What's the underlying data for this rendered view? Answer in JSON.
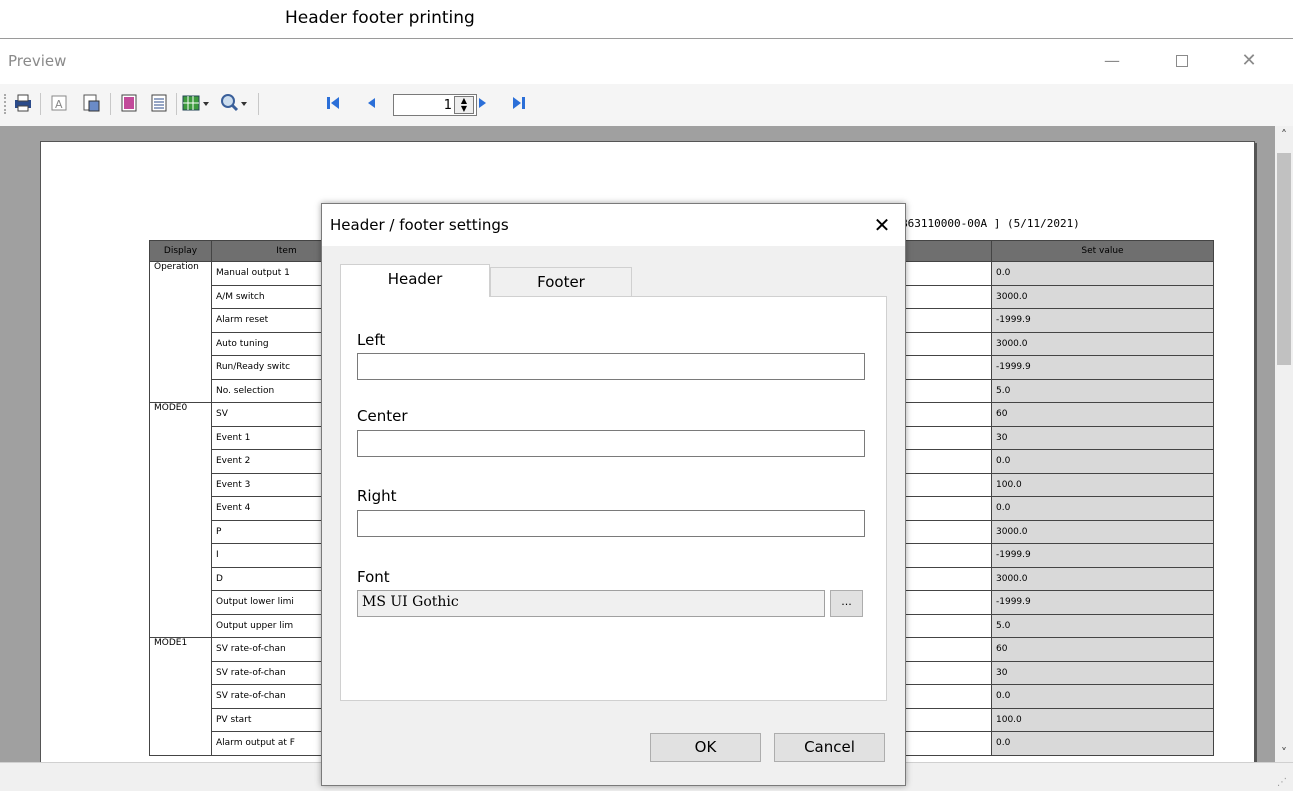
{
  "annotation": {
    "label": "Header footer printing"
  },
  "window": {
    "title": "Preview",
    "minimize": "—",
    "close": "✕"
  },
  "toolbar": {
    "page_number": "1",
    "icons": [
      "printer-icon",
      "text-icon",
      "page-setup-icon",
      "page-color-icon",
      "header-footer-icon",
      "grid-icon",
      "zoom-icon",
      "first-page-icon",
      "prev-page-icon",
      "next-page-icon",
      "last-page-icon"
    ]
  },
  "page": {
    "header_text": "B63110000-00A ] (5/11/2021)",
    "columns": {
      "display": "Display",
      "item": "Item",
      "set_value": "Set value"
    },
    "rows": [
      {
        "display": "Operation",
        "item": "Manual output 1",
        "value": "0.0"
      },
      {
        "display": "",
        "item": "A/M switch",
        "value": "3000.0"
      },
      {
        "display": "",
        "item": "Alarm reset",
        "value": "-1999.9"
      },
      {
        "display": "",
        "item": "Auto tuning",
        "value": "3000.0"
      },
      {
        "display": "",
        "item": "Run/Ready switc",
        "value": "-1999.9"
      },
      {
        "display": "",
        "item": "No. selection",
        "value": "5.0"
      },
      {
        "display": "MODE0",
        "item": "SV",
        "value": "60"
      },
      {
        "display": "",
        "item": "Event 1",
        "value": "30"
      },
      {
        "display": "",
        "item": "Event 2",
        "value": "0.0"
      },
      {
        "display": "",
        "item": "Event 3",
        "value": "100.0"
      },
      {
        "display": "",
        "item": "Event 4",
        "value": "0.0"
      },
      {
        "display": "",
        "item": "P",
        "value": "3000.0"
      },
      {
        "display": "",
        "item": "I",
        "value": "-1999.9"
      },
      {
        "display": "",
        "item": "D",
        "value": "3000.0"
      },
      {
        "display": "",
        "item": "Output lower limi",
        "value": "-1999.9"
      },
      {
        "display": "",
        "item": "Output upper lim",
        "value": "5.0"
      },
      {
        "display": "MODE1",
        "item": "SV rate-of-chan",
        "value": "60"
      },
      {
        "display": "",
        "item": "SV rate-of-chan",
        "value": "30"
      },
      {
        "display": "",
        "item": "SV rate-of-chan",
        "value": "0.0"
      },
      {
        "display": "",
        "item": "PV start",
        "value": "100.0"
      },
      {
        "display": "",
        "item": "Alarm output at F",
        "value": "0.0"
      }
    ]
  },
  "dialog": {
    "title": "Header / footer settings",
    "close": "✕",
    "tabs": {
      "header": "Header",
      "footer": "Footer"
    },
    "fields": {
      "left_label": "Left",
      "left_value": "",
      "center_label": "Center",
      "center_value": "",
      "right_label": "Right",
      "right_value": "",
      "font_label": "Font",
      "font_value": "MS UI Gothic",
      "font_browse": "..."
    },
    "ok": "OK",
    "cancel": "Cancel"
  }
}
